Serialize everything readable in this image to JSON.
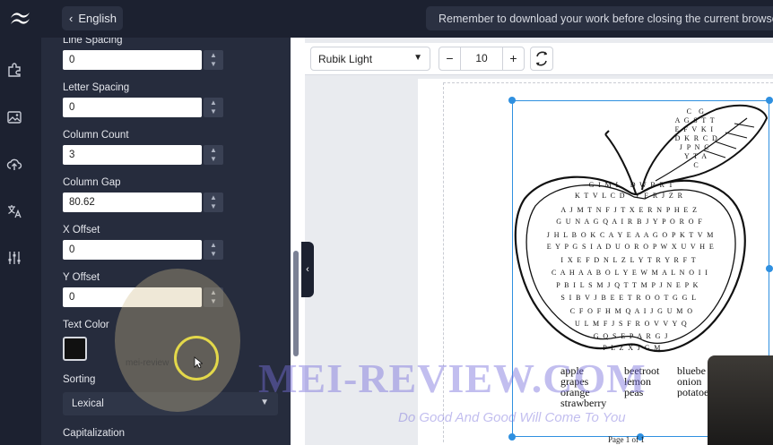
{
  "header": {
    "language_button": "English",
    "notice": "Remember to download your work before closing the current browser se"
  },
  "panel": {
    "line_spacing_label": "Line Spacing",
    "line_spacing": "0",
    "letter_spacing_label": "Letter Spacing",
    "letter_spacing": "0",
    "column_count_label": "Column Count",
    "column_count": "3",
    "column_gap_label": "Column Gap",
    "column_gap": "80.62",
    "x_offset_label": "X Offset",
    "x_offset": "0",
    "y_offset_label": "Y Offset",
    "y_offset": "0",
    "text_color_label": "Text Color",
    "text_color": "#111111",
    "sorting_label": "Sorting",
    "sorting_value": "Lexical",
    "capitalization_label": "Capitalization"
  },
  "toolbar": {
    "font": "Rubik Light",
    "minus": "−",
    "font_size": "10",
    "plus": "+"
  },
  "puzzle": {
    "grid_rows": [
      "C  G",
      "A G S T T",
      "E F V K I",
      "D K R C D",
      "J P N C",
      "Y T A",
      "C",
      "G I M L   D W B R T",
      "K T V L C D   Y E R J Z R",
      "A J M T N F J T X E R N P H E Z",
      "G U N A G Q A I R B J Y P O R O F",
      "J H L B O K C A Y E A A G O P K T V M",
      "E Y P G S I A D U O R O P W X U V H E",
      "I X E F D N L Z L Y T R Y R F T",
      "C A H A A B O L Y E W M A L N O I I",
      "P B I L S M J Q T T M P J N E P K",
      "S I B V J B E E T R O O T G G L",
      "C F O F H M Q A I J G U M O",
      "U L M F J S F R O V V Y Q",
      "G Q S E P A R G J",
      "P L Z X J G M"
    ],
    "word_col_1": [
      "apple",
      "grapes",
      "orange",
      "strawberry"
    ],
    "word_col_2": [
      "beetroot",
      "lemon",
      "peas"
    ],
    "word_col_3": [
      "bluebe",
      "onion",
      "potatoe"
    ],
    "page_label": "Page 1 of 1"
  },
  "watermark": {
    "title": "MEI-REVIEW.COM",
    "tagline": "Do Good And Good Will Come To You",
    "badge": "mei-review"
  },
  "colors": {
    "selection": "#2f90e0",
    "panel_bg": "#262c3d",
    "rail_bg": "#1c2130"
  }
}
